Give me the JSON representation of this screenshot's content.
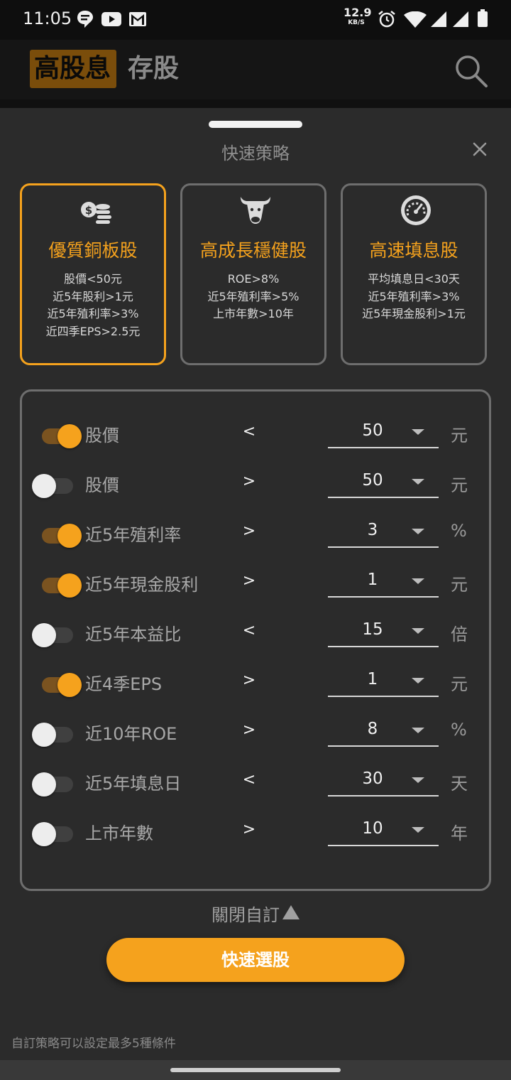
{
  "status_bar": {
    "time": "11:05",
    "net_speed_value": "12.9",
    "net_speed_unit": "KB/S",
    "left_icons": [
      "chat-bubble-icon",
      "youtube-icon",
      "gmail-icon"
    ],
    "right_icons": [
      "alarm-icon",
      "wifi-icon",
      "signal-icon",
      "signal-icon",
      "battery-icon"
    ]
  },
  "header": {
    "logo_highlight": "高股息",
    "logo_rest": "存股",
    "search_icon": "search-icon"
  },
  "sheet": {
    "title": "快速策略",
    "close_icon": "close-icon"
  },
  "strategies": [
    {
      "icon": "coins-icon",
      "title": "優質銅板股",
      "lines": [
        "股價<50元",
        "近5年股利>1元",
        "近5年殖利率>3%",
        "近四季EPS>2.5元"
      ],
      "selected": true
    },
    {
      "icon": "bull-icon",
      "title": "高成長穩健股",
      "lines": [
        "ROE>8%",
        "近5年殖利率>5%",
        "上市年數>10年"
      ],
      "selected": false
    },
    {
      "icon": "speedometer-icon",
      "title": "高速填息股",
      "lines": [
        "平均填息日<30天",
        "近5年殖利率>3%",
        "近5年現金股利>1元"
      ],
      "selected": false
    }
  ],
  "filters": [
    {
      "on": true,
      "label": "股價",
      "op": "<",
      "value": "50",
      "unit": "元"
    },
    {
      "on": false,
      "label": "股價",
      "op": ">",
      "value": "50",
      "unit": "元"
    },
    {
      "on": true,
      "label": "近5年殖利率",
      "op": ">",
      "value": "3",
      "unit": "%"
    },
    {
      "on": true,
      "label": "近5年現金股利",
      "op": ">",
      "value": "1",
      "unit": "元"
    },
    {
      "on": false,
      "label": "近5年本益比",
      "op": "<",
      "value": "15",
      "unit": "倍"
    },
    {
      "on": true,
      "label": "近4季EPS",
      "op": ">",
      "value": "1",
      "unit": "元"
    },
    {
      "on": false,
      "label": "近10年ROE",
      "op": ">",
      "value": "8",
      "unit": "%"
    },
    {
      "on": false,
      "label": "近5年填息日",
      "op": "<",
      "value": "30",
      "unit": "天"
    },
    {
      "on": false,
      "label": "上市年數",
      "op": ">",
      "value": "10",
      "unit": "年"
    }
  ],
  "collapse_label": "關閉自訂",
  "primary_button": "快速選股",
  "footer_hint": "自訂策略可以設定最多5種條件",
  "colors": {
    "accent": "#f5a21d",
    "sheet_bg": "#2b2b2b",
    "border": "#6e6e6e"
  }
}
